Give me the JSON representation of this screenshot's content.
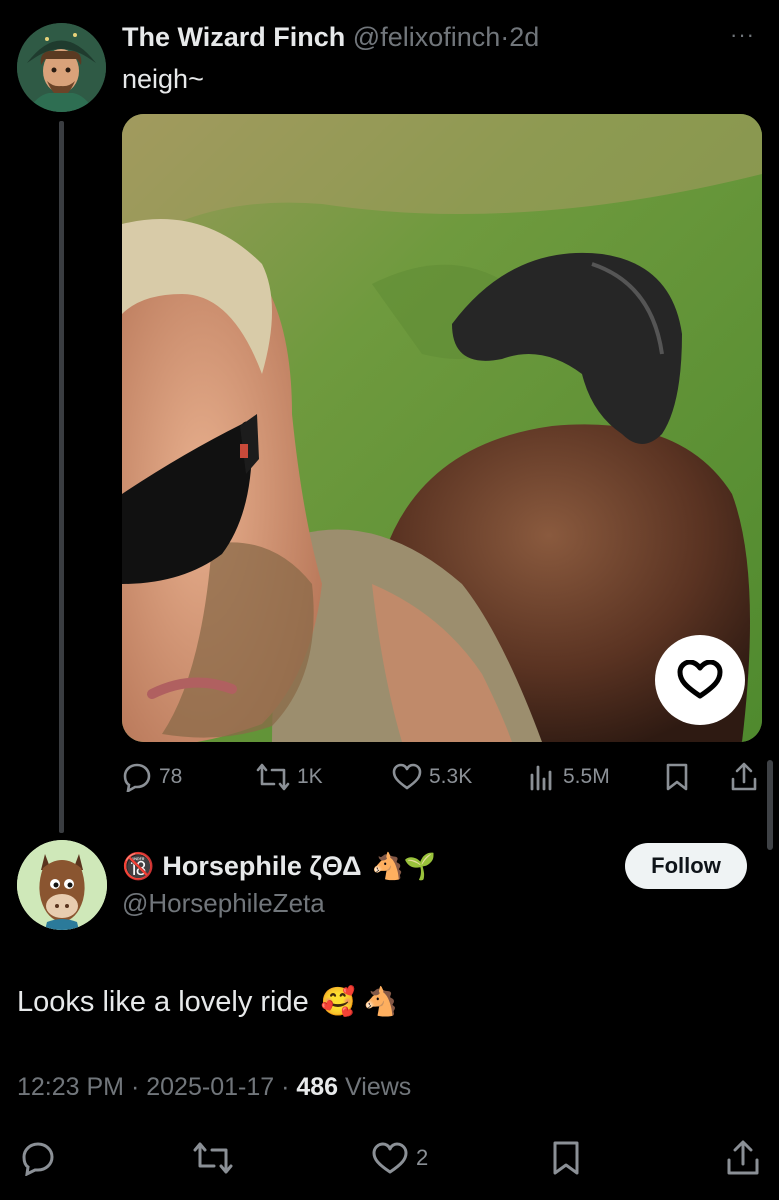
{
  "original_tweet": {
    "author_name": "The Wizard Finch",
    "handle": "@felixofinch",
    "separator": "·",
    "age": "2d",
    "more_label": "···",
    "text": "neigh~",
    "stats": {
      "replies": "78",
      "reposts": "1K",
      "likes": "5.3K",
      "views": "5.5M"
    }
  },
  "reply": {
    "badge": "🔞",
    "author_name": "Horsephile ζΘΔ",
    "name_emojis": "🐴🌱",
    "handle": "@HorsephileZeta",
    "follow_label": "Follow",
    "text": "Looks like a lovely ride",
    "text_emojis": "🥰 🐴",
    "time": "12:23 PM",
    "date": "2025-01-17",
    "dot": "·",
    "views_count": "486",
    "views_label": "Views",
    "likes": "2"
  },
  "colors": {
    "background": "#000000",
    "primary_text": "#e7e9ea",
    "secondary_text": "#71767b",
    "follow_bg": "#eff3f4"
  }
}
